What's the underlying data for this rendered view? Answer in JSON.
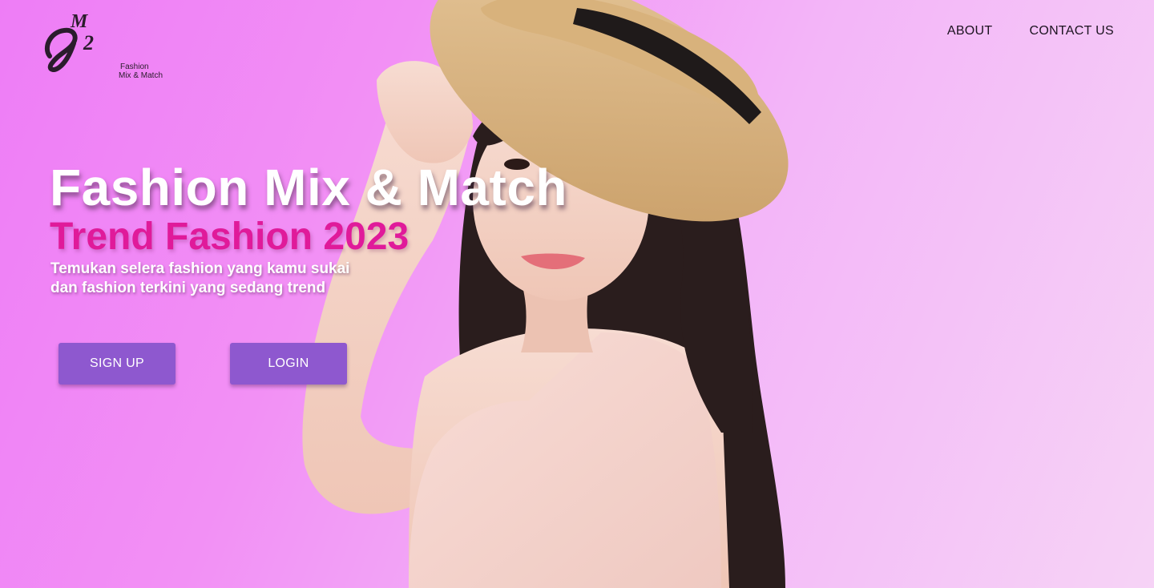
{
  "brand": {
    "monogram": "M2",
    "caption_line1": "Fashion",
    "caption_line2": "Mix & Match"
  },
  "nav": {
    "items": [
      {
        "label": "ABOUT"
      },
      {
        "label": "CONTACT US"
      }
    ]
  },
  "hero": {
    "title": "Fashion Mix & Match",
    "subtitle": "Trend Fashion 2023",
    "tagline_line1": "Temukan selera fashion yang kamu sukai",
    "tagline_line2": "dan fashion terkini yang sedang trend"
  },
  "actions": {
    "signup_label": "SIGN UP",
    "login_label": "LOGIN"
  },
  "colors": {
    "background_start": "#ee7df6",
    "background_end": "#f6d3f6",
    "subtitle": "#e01a9a",
    "button": "#8e58cf"
  }
}
